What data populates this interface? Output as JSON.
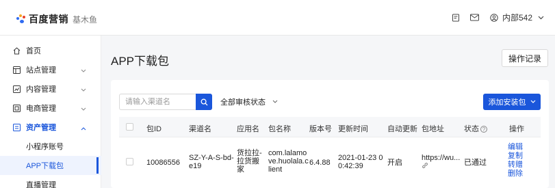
{
  "brand": {
    "name": "百度营销",
    "product": "基木鱼"
  },
  "topbar": {
    "user_name": "内部542"
  },
  "sidebar": {
    "items": [
      {
        "label": "首页",
        "icon": "home-icon"
      },
      {
        "label": "站点管理",
        "icon": "site-icon"
      },
      {
        "label": "内容管理",
        "icon": "content-icon"
      },
      {
        "label": "电商管理",
        "icon": "shop-icon"
      },
      {
        "label": "资产管理",
        "icon": "asset-icon"
      }
    ],
    "sub_items": [
      {
        "label": "小程序账号"
      },
      {
        "label": "APP下载包"
      },
      {
        "label": "直播管理"
      }
    ]
  },
  "page": {
    "title": "APP下载包",
    "log_button": "操作记录"
  },
  "toolbar": {
    "search_placeholder": "请输入渠道名",
    "filter_label": "全部审核状态",
    "add_button": "添加安装包"
  },
  "table": {
    "headers": [
      "包ID",
      "渠道名",
      "应用名",
      "包名称",
      "版本号",
      "更新时间",
      "自动更新",
      "包地址",
      "状态",
      "操作"
    ],
    "rows": [
      {
        "id": "10086556",
        "channel_l1": "SZ-Y-A-S-bd-",
        "channel_l2": "e19",
        "app_l1": "货拉拉-",
        "app_l2": "拉货搬",
        "app_l3": "家",
        "pkg_l1": "com.lalamo",
        "pkg_l2": "ve.huolala.c",
        "pkg_l3": "lient",
        "version": "6.4.88",
        "time_l1": "2021-01-23 0",
        "time_l2": "0:42:39",
        "auto_update": "开启",
        "url": "https://wu...",
        "status": "已通过",
        "actions": [
          "编辑",
          "复制",
          "转赠",
          "删除"
        ]
      }
    ]
  },
  "colors": {
    "accent": "#1a56db",
    "background": "#f5f6f8"
  }
}
